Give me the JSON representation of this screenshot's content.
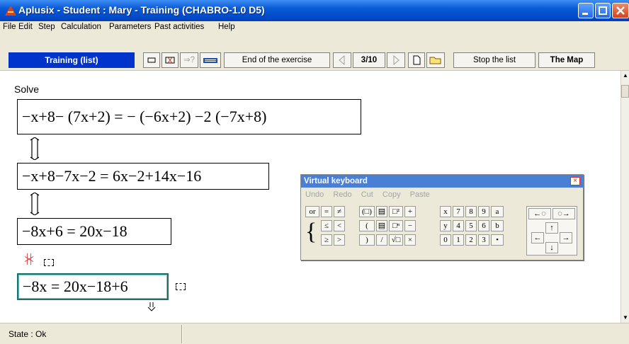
{
  "window": {
    "title": "Aplusix - Student : Mary - Training (CHABRO-1.0 D5)",
    "title_color": "#0a5ad6"
  },
  "menu": [
    {
      "label": "File"
    },
    {
      "label": "Edit"
    },
    {
      "label": "Step"
    },
    {
      "label": "Calculation"
    },
    {
      "label": "Parameters"
    },
    {
      "label": "Past activities"
    },
    {
      "label": "Help"
    }
  ],
  "toolbar": {
    "mode": "Training (list)",
    "end_exercise": "End of the exercise",
    "page_counter": "3/10",
    "stop_list": "Stop the list",
    "map": "The Map",
    "help_icon_label": "⇒?",
    "mode_color": "#0033cc"
  },
  "main": {
    "instruction": "Solve",
    "expressions": [
      {
        "text": "−x+8− (7x+2) = − (−6x+2) −2 (−7x+8)"
      },
      {
        "text": "−x+8−7x−2 = 6x−2+14x−16"
      },
      {
        "text": "−8x+6 = 20x−18"
      },
      {
        "text": "−8x = 20x−18+6"
      }
    ],
    "links": [
      "equivalent",
      "equivalent",
      "not-equivalent"
    ]
  },
  "status": {
    "text": "State : Ok"
  },
  "keyboard": {
    "title": "Virtual keyboard",
    "close": "×",
    "edit_actions": [
      "Undo",
      "Redo",
      "Cut",
      "Copy",
      "Paste"
    ],
    "row1": [
      "or",
      "=",
      "≠",
      "(□)",
      "▤",
      "□²",
      "+",
      "x",
      "7",
      "8",
      "9",
      "a"
    ],
    "row2": [
      "≤",
      "<",
      "(",
      "▤",
      "□ⁿ",
      "−",
      "y",
      "4",
      "5",
      "6",
      "b"
    ],
    "row3": [
      "≥",
      ">",
      ")",
      "/",
      "√□",
      "×",
      "0",
      "1",
      "2",
      "3",
      "•"
    ],
    "brace": "{",
    "arrow_keys": [
      "←◌",
      "◌→",
      "↑",
      "←",
      "→",
      "↓"
    ]
  }
}
